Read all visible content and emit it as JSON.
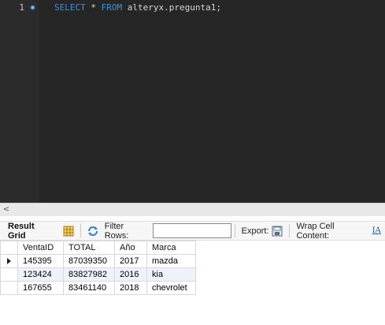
{
  "editor": {
    "line_number": "1",
    "code": {
      "kw_select": "SELECT",
      "star": " * ",
      "kw_from": "FROM",
      "rest": " alteryx.pregunta1;"
    }
  },
  "scrollbar": {
    "left_arrow": "<"
  },
  "toolbar": {
    "result_grid": "Result Grid",
    "filter_rows": "Filter Rows:",
    "filter_value": "",
    "export": "Export:",
    "wrap_cell": "Wrap Cell Content:",
    "wrap_icon_glyph": "IA"
  },
  "grid": {
    "columns": [
      "VentaID",
      "TOTAL",
      "Año",
      "Marca"
    ],
    "rows": [
      [
        "145395",
        "87039350",
        "2017",
        "mazda"
      ],
      [
        "123424",
        "83827982",
        "2016",
        "kia"
      ],
      [
        "167655",
        "83461140",
        "2018",
        "chevrolet"
      ]
    ]
  },
  "colors": {
    "editor_bg": "#262626",
    "keyword": "#3e8fd8",
    "code_text": "#d6d6d6",
    "alt_row": "#eef3fb"
  }
}
